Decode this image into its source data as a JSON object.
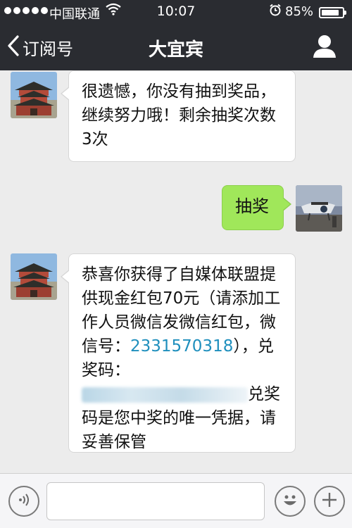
{
  "status_bar": {
    "carrier": "中国联通",
    "time": "10:07",
    "battery_percent": "85%",
    "battery_level": 0.85,
    "icons": [
      "signal-dots-icon",
      "wifi-icon",
      "alarm-icon",
      "battery-icon"
    ]
  },
  "nav": {
    "back_label": "订阅号",
    "title": "大宜宾",
    "icons": [
      "back-chevron-icon",
      "profile-icon"
    ]
  },
  "messages": [
    {
      "side": "left",
      "sender": "official-account",
      "text": "很遗憾，你没有抽到奖品，继续努力哦！剩余抽奖次数3次"
    },
    {
      "side": "right",
      "sender": "user",
      "text": "抽奖"
    },
    {
      "side": "left",
      "sender": "official-account",
      "text_part1": "恭喜你获得了自媒体联盟提供现金红包70元（请添加工作人员微信发微信红包，微信号：",
      "wechat_id": "2331570318",
      "text_part2": "），兑奖码：",
      "code_obscured": true,
      "text_part3": "兑奖码是您中奖的唯一凭据，请妥善保管"
    }
  ],
  "input_bar": {
    "value": "",
    "icons": [
      "voice-icon",
      "emoji-icon",
      "plus-icon"
    ]
  },
  "colors": {
    "nav_bg": "#2a2c31",
    "chat_bg": "#ececec",
    "sent_bubble": "#a0e75a",
    "received_bubble": "#ffffff",
    "link_blue": "#1f8fbd"
  }
}
